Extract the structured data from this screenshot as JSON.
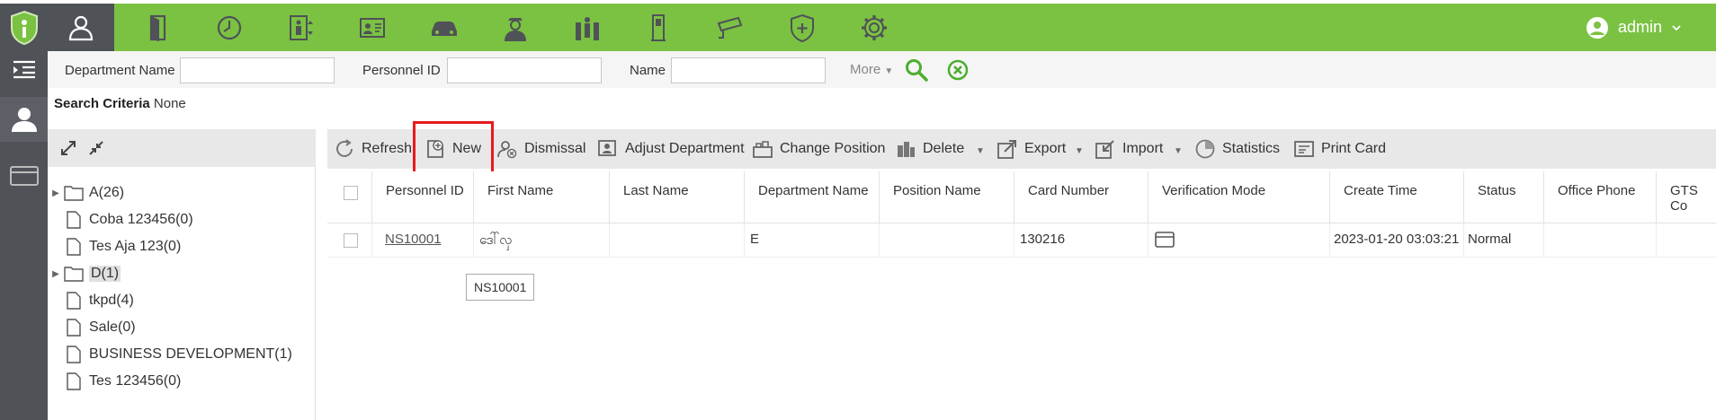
{
  "topbar": {
    "nav": [
      {
        "name": "personnel-icon",
        "active": true
      },
      {
        "name": "door-access-icon"
      },
      {
        "name": "attendance-clock-icon"
      },
      {
        "name": "elevator-icon"
      },
      {
        "name": "visitor-card-icon"
      },
      {
        "name": "parking-car-icon"
      },
      {
        "name": "patrol-guard-icon"
      },
      {
        "name": "passage-gate-icon"
      },
      {
        "name": "kiosk-icon"
      },
      {
        "name": "video-camera-icon"
      },
      {
        "name": "security-shield-icon"
      },
      {
        "name": "settings-gear-icon"
      }
    ],
    "user": "admin"
  },
  "search": {
    "dept_label": "Department Name",
    "dept_value": "",
    "pid_label": "Personnel ID",
    "pid_value": "",
    "name_label": "Name",
    "name_value": "",
    "more": "More",
    "criteria_label": "Search Criteria",
    "criteria_value": "None"
  },
  "tree": [
    {
      "label": "A(26)",
      "type": "folder",
      "expandable": true
    },
    {
      "label": "Coba 123456(0)",
      "type": "file"
    },
    {
      "label": "Tes Aja 123(0)",
      "type": "file"
    },
    {
      "label": "D(1)",
      "type": "folder",
      "expandable": true,
      "selected": true
    },
    {
      "label": "tkpd(4)",
      "type": "file"
    },
    {
      "label": "Sale(0)",
      "type": "file"
    },
    {
      "label": "BUSINESS DEVELOPMENT(1)",
      "type": "file"
    },
    {
      "label": "Tes 123456(0)",
      "type": "file"
    }
  ],
  "toolbar": {
    "refresh": "Refresh",
    "new": "New",
    "dismissal": "Dismissal",
    "adjust_department": "Adjust Department",
    "change_position": "Change Position",
    "delete": "Delete",
    "export": "Export",
    "import": "Import",
    "statistics": "Statistics",
    "print_card": "Print Card"
  },
  "table": {
    "columns": [
      "Personnel ID",
      "First Name",
      "Last Name",
      "Department Name",
      "Position Name",
      "Card Number",
      "Verification Mode",
      "Create Time",
      "Status",
      "Office Phone",
      "GTS Co"
    ],
    "rows": [
      {
        "personnel_id": "NS10001",
        "first_name": "ဒေါ်လှ",
        "last_name": "",
        "department": "E",
        "position": "",
        "card_number": "130216",
        "verification_icon": "card-icon",
        "create_time": "2023-01-20 03:03:21",
        "status": "Normal",
        "office_phone": "",
        "gts": ""
      }
    ],
    "tooltip": "NS10001"
  },
  "colors": {
    "brand_green": "#7bc242",
    "dark_rail": "#4f5257",
    "highlight_red": "#e8191f",
    "search_green": "#4cae2e"
  }
}
